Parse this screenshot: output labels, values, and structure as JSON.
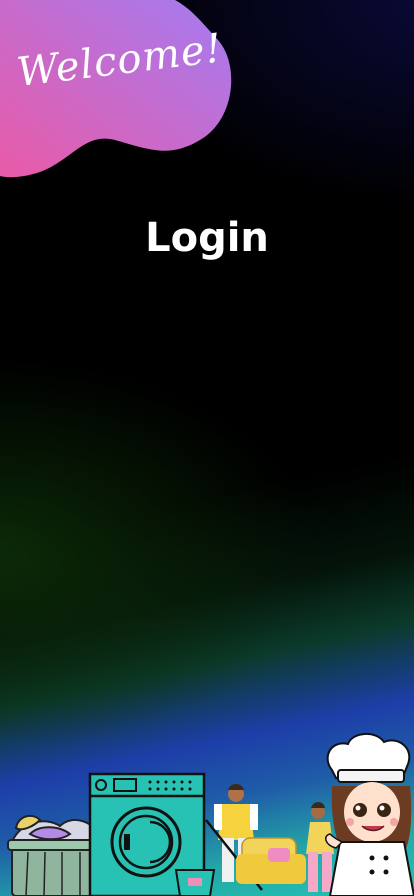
{
  "header": {
    "greeting": "Welcome!"
  },
  "main": {
    "title": "Login"
  },
  "colors": {
    "blob_start": "#e95aa6",
    "blob_end": "#a77bf0",
    "title": "#ffffff"
  },
  "illustration": {
    "items": [
      "laundry-basket-icon",
      "washing-machine-icon",
      "cleaner-with-mop-icon",
      "cleaner-with-sofa-icon",
      "chef-girl-icon"
    ]
  }
}
